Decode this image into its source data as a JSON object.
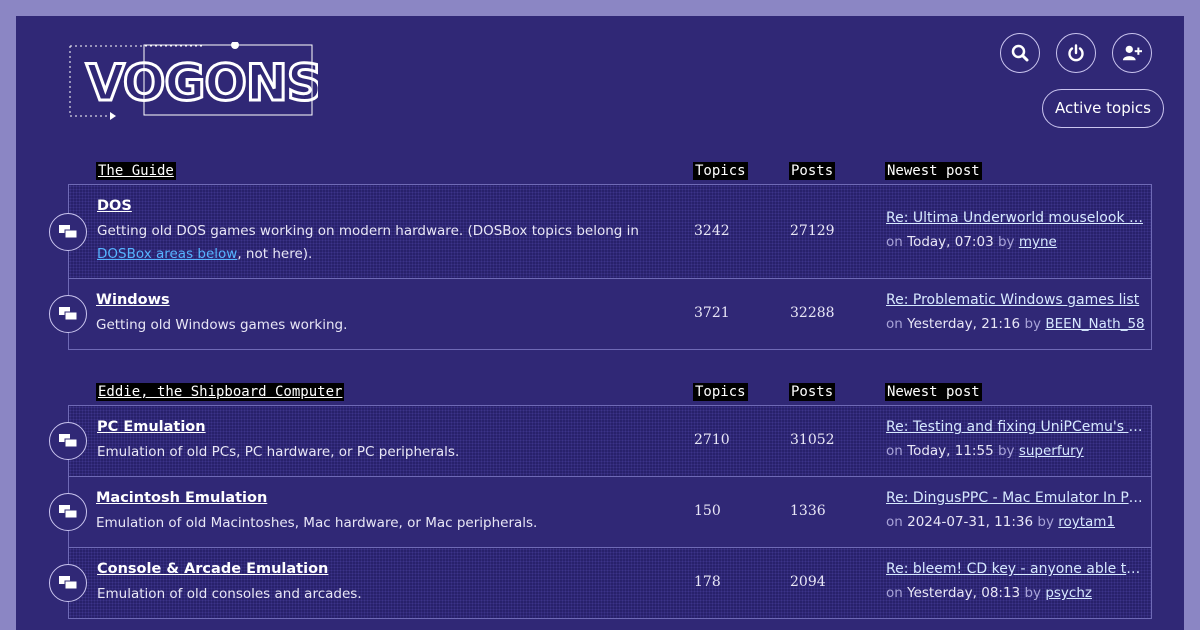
{
  "logo": {
    "text": "VOGONS"
  },
  "header": {
    "search_icon": "search-icon",
    "power_icon": "power-icon",
    "register_icon": "add-user-icon",
    "active_topics_label": "Active topics"
  },
  "columns": {
    "topics": "Topics",
    "posts": "Posts",
    "newest": "Newest post"
  },
  "sections": [
    {
      "title": "The Guide",
      "forums": [
        {
          "title": "DOS",
          "desc_before": "Getting old DOS games working on modern hardware. (DOSBox topics belong in ",
          "desc_link": "DOSBox areas below",
          "desc_after": ", not here).",
          "topics": "3242",
          "posts": "27129",
          "newest_title": "Re: Ultima Underworld mouselook …",
          "on": "on",
          "date": "Today, 07:03",
          "by": "by",
          "author": "myne"
        },
        {
          "title": "Windows",
          "desc": "Getting old Windows games working.",
          "topics": "3721",
          "posts": "32288",
          "newest_title": "Re: Problematic Windows games list",
          "on": "on",
          "date": "Yesterday, 21:16",
          "by": "by",
          "author": "BEEN_Nath_58"
        }
      ]
    },
    {
      "title": "Eddie, the Shipboard Computer",
      "forums": [
        {
          "title": "PC Emulation",
          "desc": "Emulation of old PCs, PC hardware, or PC peripherals.",
          "topics": "2710",
          "posts": "31052",
          "newest_title": "Re: Testing and fixing UniPCemu's C…",
          "on": "on",
          "date": "Today, 11:55",
          "by": "by",
          "author": "superfury"
        },
        {
          "title": "Macintosh Emulation",
          "desc": "Emulation of old Macintoshes, Mac hardware, or Mac peripherals.",
          "topics": "150",
          "posts": "1336",
          "newest_title": "Re: DingusPPC - Mac Emulator In Pr…",
          "on": "on",
          "date": "2024-07-31, 11:36",
          "by": "by",
          "author": "roytam1"
        },
        {
          "title": "Console & Arcade Emulation",
          "desc": "Emulation of old consoles and arcades.",
          "topics": "178",
          "posts": "2094",
          "newest_title": "Re: bleem! CD key - anyone able to s…",
          "on": "on",
          "date": "Yesterday, 08:13",
          "by": "by",
          "author": "psychz"
        }
      ]
    }
  ],
  "colors": {
    "page_bg": "#302876",
    "outer_bg": "#8b86c4",
    "link": "#56b4ff"
  }
}
